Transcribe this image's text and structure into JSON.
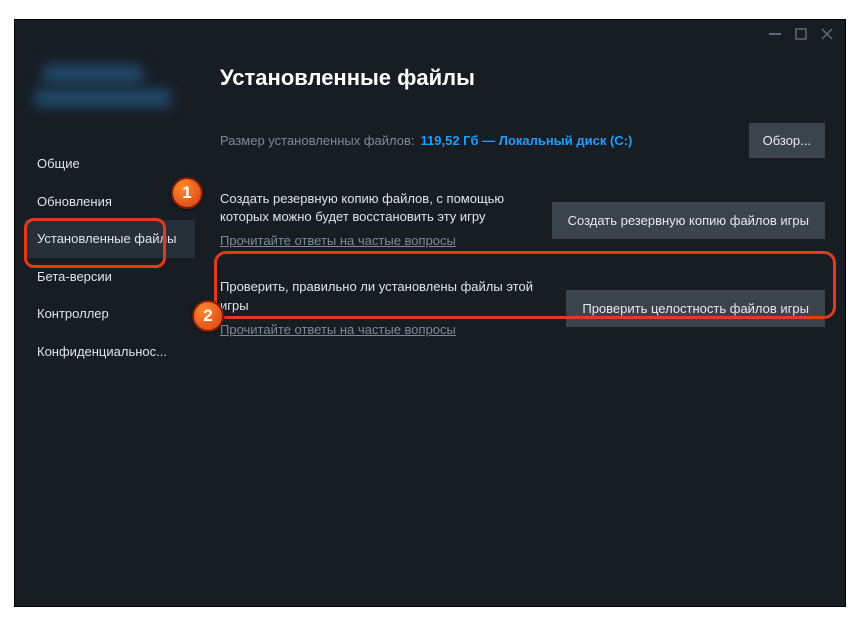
{
  "window": {
    "title_blurred": true
  },
  "sidebar": {
    "items": [
      {
        "label": "Общие"
      },
      {
        "label": "Обновления"
      },
      {
        "label": "Установленные файлы",
        "active": true
      },
      {
        "label": "Бета-версии"
      },
      {
        "label": "Контроллер"
      },
      {
        "label": "Конфиденциальнос..."
      }
    ]
  },
  "content": {
    "title": "Установленные файлы",
    "size_label": "Размер установленных файлов:",
    "size_value": "119,52 Гб — Локальный диск (C:)",
    "browse_button": "Обзор...",
    "backup": {
      "desc": "Создать резервную копию файлов, с помощью которых можно будет восстановить эту игру",
      "faq": "Прочитайте ответы на частые вопросы",
      "button": "Создать резервную копию файлов игры"
    },
    "verify": {
      "desc": "Проверить, правильно ли установлены файлы этой игры",
      "faq": "Прочитайте ответы на частые вопросы",
      "button": "Проверить целостность файлов игры"
    }
  },
  "annotations": {
    "badge1": "1",
    "badge2": "2"
  }
}
